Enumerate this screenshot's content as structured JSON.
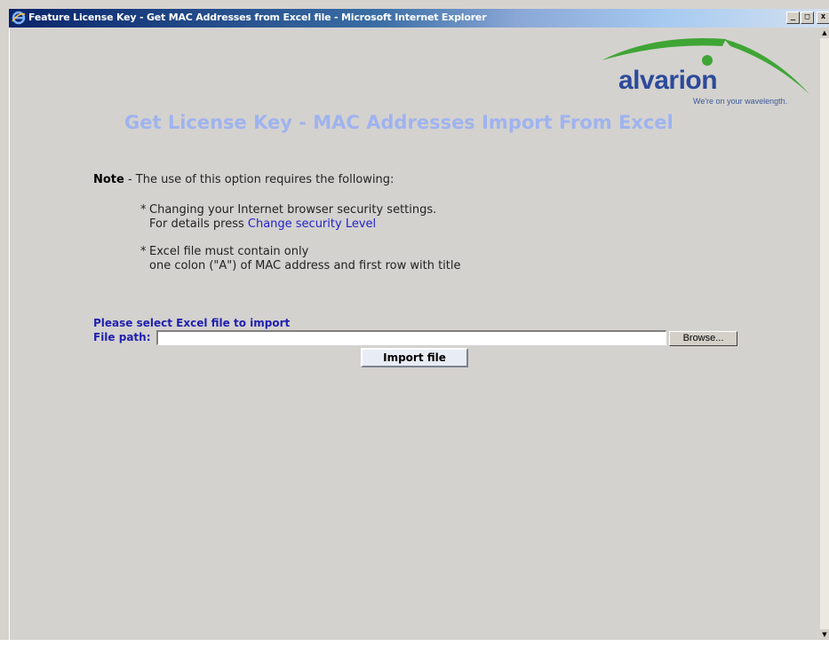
{
  "window": {
    "title": "Feature License Key - Get MAC Addresses from Excel file - Microsoft Internet Explorer",
    "minimize_glyph": "_",
    "maximize_glyph": "□",
    "close_glyph": "x"
  },
  "logo": {
    "word": "alvarion",
    "tagline": "We're on your wavelength.",
    "brand_color": "#2b4a9a",
    "swoosh_color": "#3fa535"
  },
  "page": {
    "title": "Get License Key - MAC Addresses Import From Excel",
    "title_color": "#9fb3ee"
  },
  "note": {
    "label": "Note",
    "text": " - The use of this option requires the following:",
    "bullets": [
      {
        "line1": "Changing your Internet browser security settings.",
        "line2_prefix": "For details press ",
        "link_text": "Change security Level"
      },
      {
        "line1": "Excel file must contain only",
        "line2": "one colon (\"A\") of MAC address and first row with title"
      }
    ],
    "bullet_glyph": "*"
  },
  "import_form": {
    "select_label": "Please select Excel file to import",
    "path_label": "File path:",
    "path_value": "",
    "browse_label": "Browse...",
    "import_label": "Import file"
  }
}
